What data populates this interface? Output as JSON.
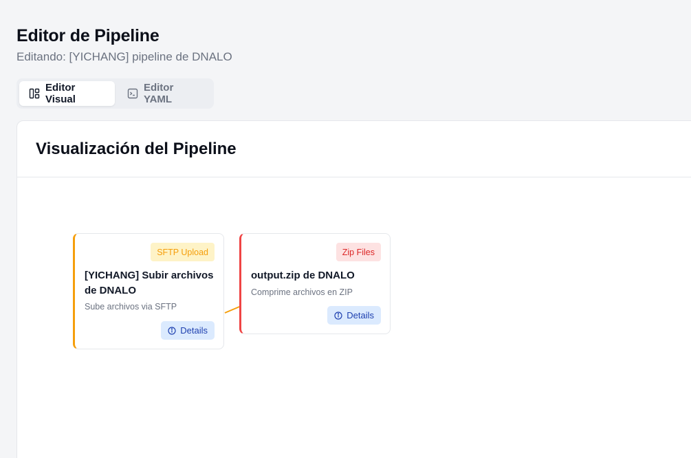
{
  "header": {
    "title": "Editor de Pipeline",
    "subtitle": "Editando: [YICHANG] pipeline de DNALO"
  },
  "tabs": [
    {
      "label": "Editor Visual",
      "icon": "layout-icon",
      "active": true
    },
    {
      "label": "Editor YAML",
      "icon": "terminal-icon",
      "active": false
    }
  ],
  "panel": {
    "title": "Visualización del Pipeline"
  },
  "nodes": [
    {
      "badge": "SFTP Upload",
      "title": "[YICHANG] Subir archivos de DNALO",
      "description": "Sube archivos via SFTP",
      "details_label": "Details",
      "accent": "#f59e0b"
    },
    {
      "badge": "Zip Files",
      "title": "output.zip de DNALO",
      "description": "Comprime archivos en ZIP",
      "details_label": "Details",
      "accent": "#ef4444"
    }
  ],
  "colors": {
    "connector": "#f59e0b",
    "details_bg": "#dbeafe",
    "details_text": "#1e40af"
  }
}
